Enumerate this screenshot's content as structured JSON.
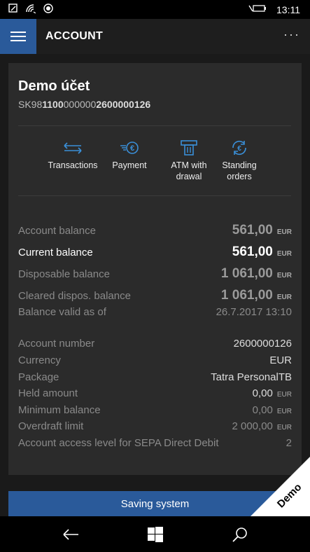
{
  "status": {
    "time": "13:11"
  },
  "appbar": {
    "title": "ACCOUNT",
    "more": "···"
  },
  "account": {
    "name": "Demo účet",
    "iban_parts": [
      "SK98",
      "1100",
      "000000",
      "2600000126"
    ]
  },
  "actions": [
    {
      "label_line1": "Transactions",
      "label_line2": "",
      "icon": "transfer-arrows-icon"
    },
    {
      "label_line1": "Payment",
      "label_line2": "",
      "icon": "euro-payment-icon"
    },
    {
      "label_line1": "ATM with",
      "label_line2": "drawal",
      "icon": "atm-icon"
    },
    {
      "label_line1": "Standing",
      "label_line2": "orders",
      "icon": "euro-cycle-icon"
    }
  ],
  "balances": [
    {
      "label": "Account balance",
      "value": "561,00",
      "unit": "EUR"
    },
    {
      "label": "Current balance",
      "value": "561,00",
      "unit": "EUR"
    },
    {
      "label": "Disposable balance",
      "value": "1 061,00",
      "unit": "EUR"
    },
    {
      "label": "Cleared dispos. balance",
      "value": "1 061,00",
      "unit": "EUR"
    },
    {
      "label": "Balance valid as of",
      "value": "26.7.2017 13:10"
    }
  ],
  "details": [
    {
      "label": "Account number",
      "value": "2600000126"
    },
    {
      "label": "Currency",
      "value": "EUR"
    },
    {
      "label": "Package",
      "value": "Tatra PersonalTB"
    },
    {
      "label": "Held amount",
      "value": "0,00",
      "unit": "EUR"
    },
    {
      "label": "Minimum balance",
      "value": "0,00",
      "unit": "EUR"
    },
    {
      "label": "Overdraft limit",
      "value": "2 000,00",
      "unit": "EUR"
    },
    {
      "label": "Account access level for SEPA Direct Debit",
      "value": "2"
    }
  ],
  "saving_button": "Saving system",
  "demo_badge": "Demo",
  "colors": {
    "accent": "#2a5a9a",
    "icon_blue": "#3a8fd8"
  }
}
